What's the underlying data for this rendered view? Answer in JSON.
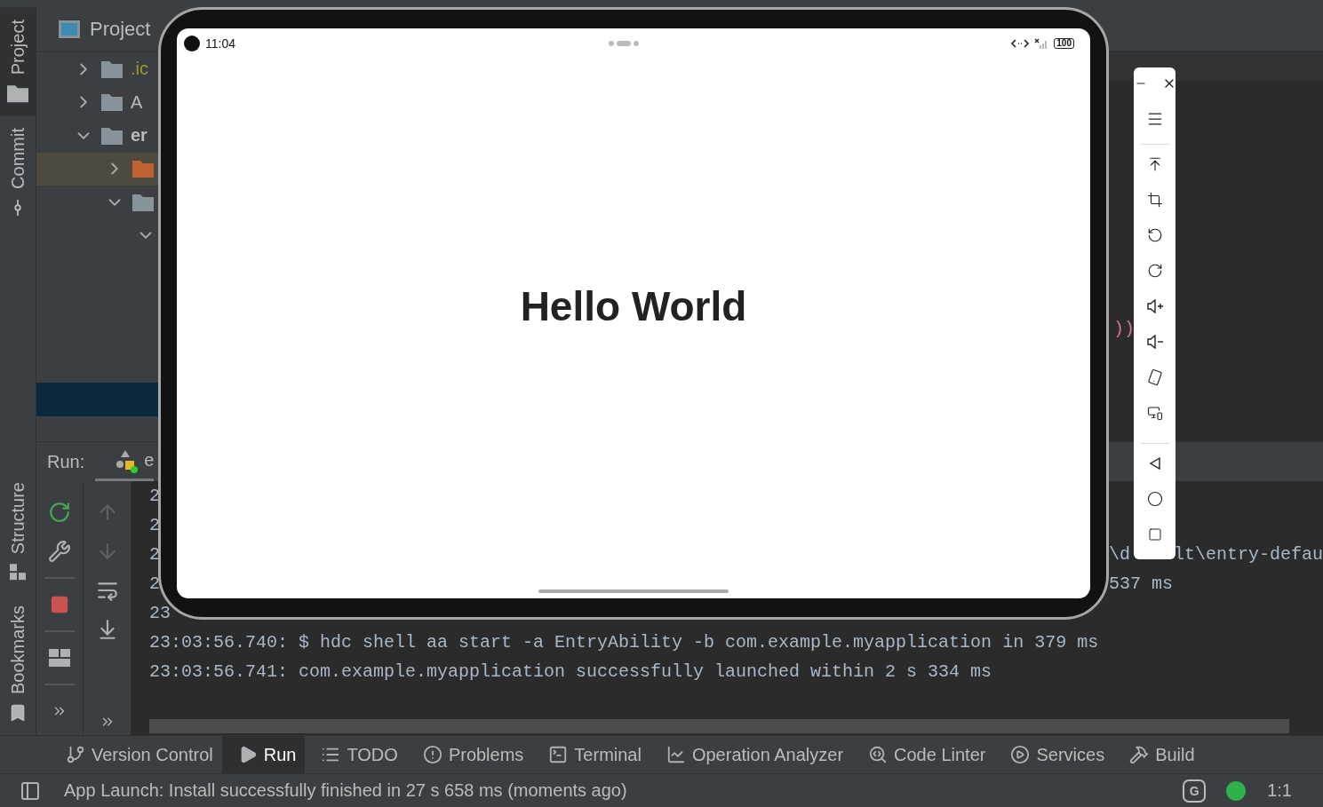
{
  "tool_stripe": {
    "top": [
      {
        "label": "Project",
        "selected": true
      },
      {
        "label": "Commit",
        "selected": false
      }
    ],
    "bottom": [
      {
        "label": "Structure"
      },
      {
        "label": "Bookmarks"
      }
    ]
  },
  "project_panel": {
    "title": "Project",
    "tree": [
      {
        "label": ".ic",
        "kind": "folder",
        "ignored": true,
        "expanded": false,
        "selected": false
      },
      {
        "label": "A",
        "kind": "folder",
        "ignored": false,
        "expanded": false,
        "selected": false
      },
      {
        "label": "er",
        "kind": "module",
        "ignored": false,
        "expanded": true,
        "selected": false,
        "children": [
          {
            "kind": "excluded",
            "expanded": false,
            "selected": true
          },
          {
            "kind": "folder",
            "expanded": true,
            "selected": false,
            "children": [
              {
                "expanded": true,
                "selected": false
              }
            ]
          }
        ]
      }
    ]
  },
  "editor": {
    "fragment": "))"
  },
  "run_panel": {
    "label": "Run:",
    "config": "e",
    "lines": [
      {
        "kind": "partial",
        "fragments": [
          "2"
        ]
      },
      {
        "kind": "partial",
        "fragments": [
          "2"
        ]
      },
      {
        "kind": "partial",
        "fragments": [
          "2",
          "\\d",
          "lt\\entry-defau"
        ]
      },
      {
        "kind": "partial",
        "fragments": [
          "2",
          "537 ms"
        ]
      },
      {
        "kind": "partial",
        "fragments": [
          "23"
        ]
      },
      {
        "kind": "full",
        "fragments": [
          "23:03:56.740: $ hdc shell aa start -a EntryAbility -b com.example.myapplication in 379 ms"
        ]
      },
      {
        "kind": "full",
        "fragments": [
          "23:03:56.741: com.example.myapplication successfully launched within 2 s 334 ms"
        ]
      }
    ]
  },
  "bottom_tabs": [
    {
      "label": "Version Control",
      "selected": false
    },
    {
      "label": "Run",
      "selected": true
    },
    {
      "label": "TODO",
      "selected": false
    },
    {
      "label": "Problems",
      "selected": false
    },
    {
      "label": "Terminal",
      "selected": false
    },
    {
      "label": "Operation Analyzer",
      "selected": false
    },
    {
      "label": "Code Linter",
      "selected": false
    },
    {
      "label": "Services",
      "selected": false
    },
    {
      "label": "Build",
      "selected": false
    }
  ],
  "status_bar": {
    "message": "App Launch: Install successfully finished in 27 s 658 ms (moments ago)",
    "badge": "G",
    "position": "1:1"
  },
  "emulator": {
    "time": "11:04",
    "battery": "100",
    "content": "Hello World"
  }
}
